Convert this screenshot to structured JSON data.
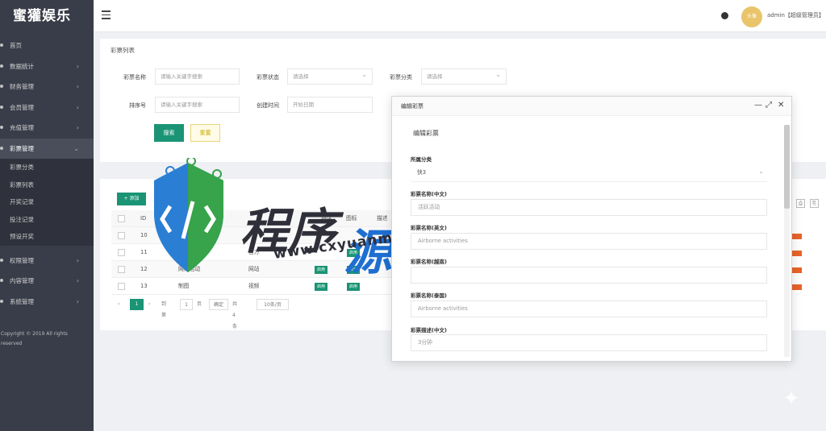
{
  "sidebar": {
    "brand": "蜜獾娱乐",
    "items": [
      {
        "label": "首页"
      },
      {
        "label": "数据统计",
        "arrow": "›"
      },
      {
        "label": "财务管理",
        "arrow": "›"
      },
      {
        "label": "会员管理",
        "arrow": "›"
      },
      {
        "label": "充值管理",
        "arrow": "›"
      },
      {
        "label": "彩票管理",
        "arrow": "⌄"
      }
    ],
    "subitems": [
      {
        "label": "彩票分类"
      },
      {
        "label": "彩票列表"
      },
      {
        "label": "开奖记录"
      },
      {
        "label": "投注记录"
      },
      {
        "label": "预设开奖"
      }
    ],
    "items2": [
      {
        "label": "权限管理",
        "arrow": "›"
      },
      {
        "label": "内容管理",
        "arrow": "›"
      },
      {
        "label": "系统管理",
        "arrow": "›"
      }
    ],
    "copyright": "Copyright © 2019 All rights reserved"
  },
  "topbar": {
    "user": "admin【超级管理员】",
    "avatar_text": "头像"
  },
  "search_panel": {
    "title": "彩票列表",
    "fields": {
      "name_label": "彩票名称",
      "name_placeholder": "请输入关键字搜索",
      "status_label": "彩票状态",
      "status_value": "请选择",
      "category_label": "彩票分类",
      "category_value": "请选择",
      "sort_label": "排序号",
      "sort_placeholder": "请输入关键字搜索",
      "time_label": "创建时间",
      "time_placeholder": "开始日期"
    },
    "search_button": "搜索",
    "reset_button": "重置"
  },
  "table_panel": {
    "add_button": "+ 添加",
    "columns": [
      "ID",
      "",
      "排序",
      "图标",
      "描述"
    ],
    "rows": [
      {
        "id": "10",
        "name": "",
        "type": ""
      },
      {
        "id": "11",
        "name": "网络活动",
        "type": "官方"
      },
      {
        "id": "12",
        "name": "网络活动",
        "type": "网站"
      },
      {
        "id": "13",
        "name": "制图",
        "type": "视频"
      }
    ],
    "row_tag": "启用",
    "pager": {
      "prev": "‹",
      "current": "1",
      "next": "›",
      "goto_label": "到第",
      "goto_value": "1",
      "page_unit": "页",
      "confirm": "确定",
      "total": "共4条",
      "per_page": "10条/页"
    }
  },
  "modal": {
    "title": "编辑彩票",
    "form_title": "编辑彩票",
    "fields": [
      {
        "label": "所属分类",
        "value": "快3",
        "type": "select"
      },
      {
        "label": "彩票名称(中文)",
        "value": "活跃活动",
        "type": "input"
      },
      {
        "label": "彩票名称(英文)",
        "value": "Airborne activities",
        "type": "input"
      },
      {
        "label": "彩票名称(越南)",
        "value": "",
        "type": "input"
      },
      {
        "label": "彩票名称(泰国)",
        "value": "Airborne activities",
        "type": "input"
      },
      {
        "label": "彩票描述(中文)",
        "value": "3分钟",
        "type": "input"
      }
    ]
  },
  "watermark": {
    "url": "www.cxyuanma.com"
  },
  "colors": {
    "sidebar_bg": "#393d49",
    "primary": "#1a9474",
    "warning_tag": "#e8632a"
  }
}
